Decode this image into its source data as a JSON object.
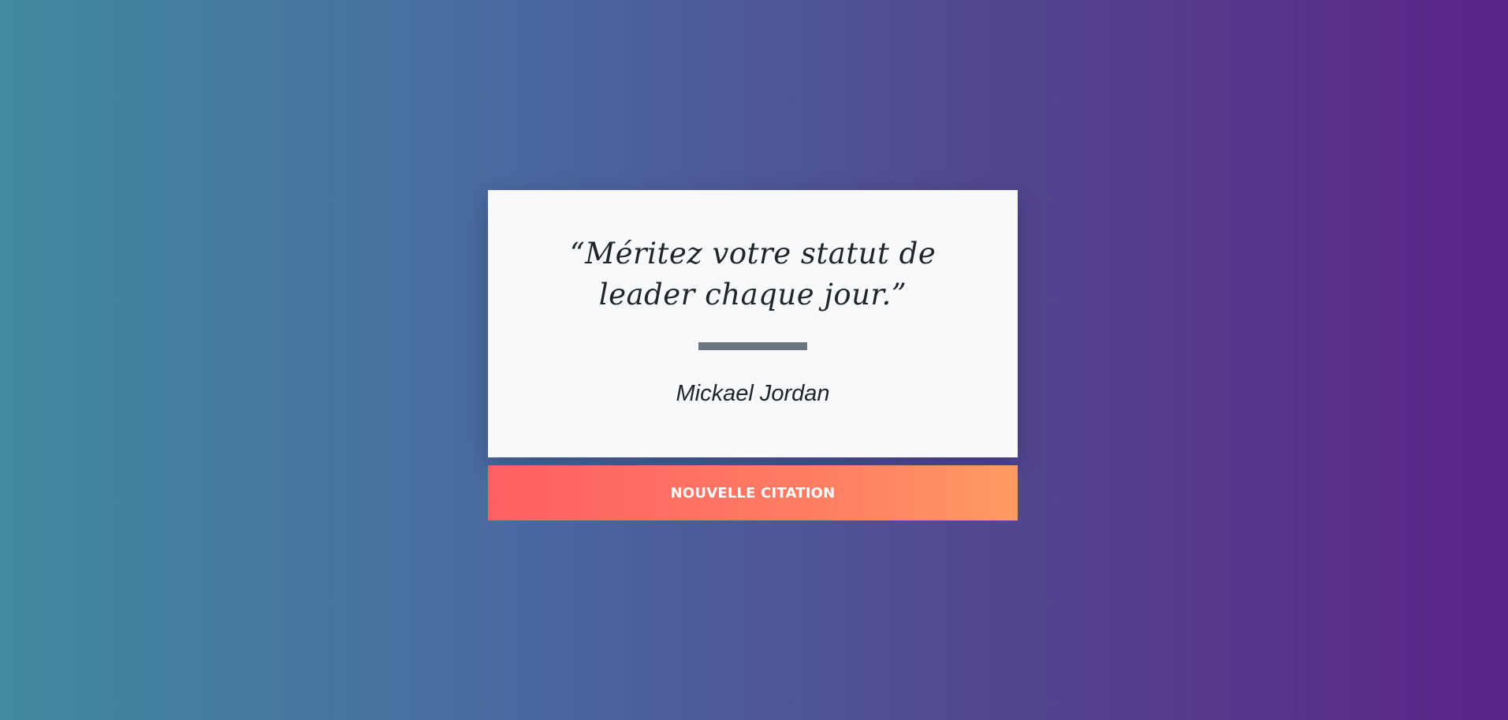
{
  "colors": {
    "background_gradient": [
      "#418a9f",
      "#4a68a0",
      "#52488f",
      "#5b2488"
    ],
    "card_background": "#f8f9fa",
    "divider": "#6c757d",
    "text": "#212529",
    "button_gradient": [
      "#ff5f63",
      "#ff9a63"
    ],
    "button_text": "#ffffff"
  },
  "quote": {
    "text": "“Méritez votre statut de leader chaque jour.”",
    "author": "Mickael Jordan"
  },
  "actions": {
    "new_quote_label": "NOUVELLE CITATION"
  }
}
